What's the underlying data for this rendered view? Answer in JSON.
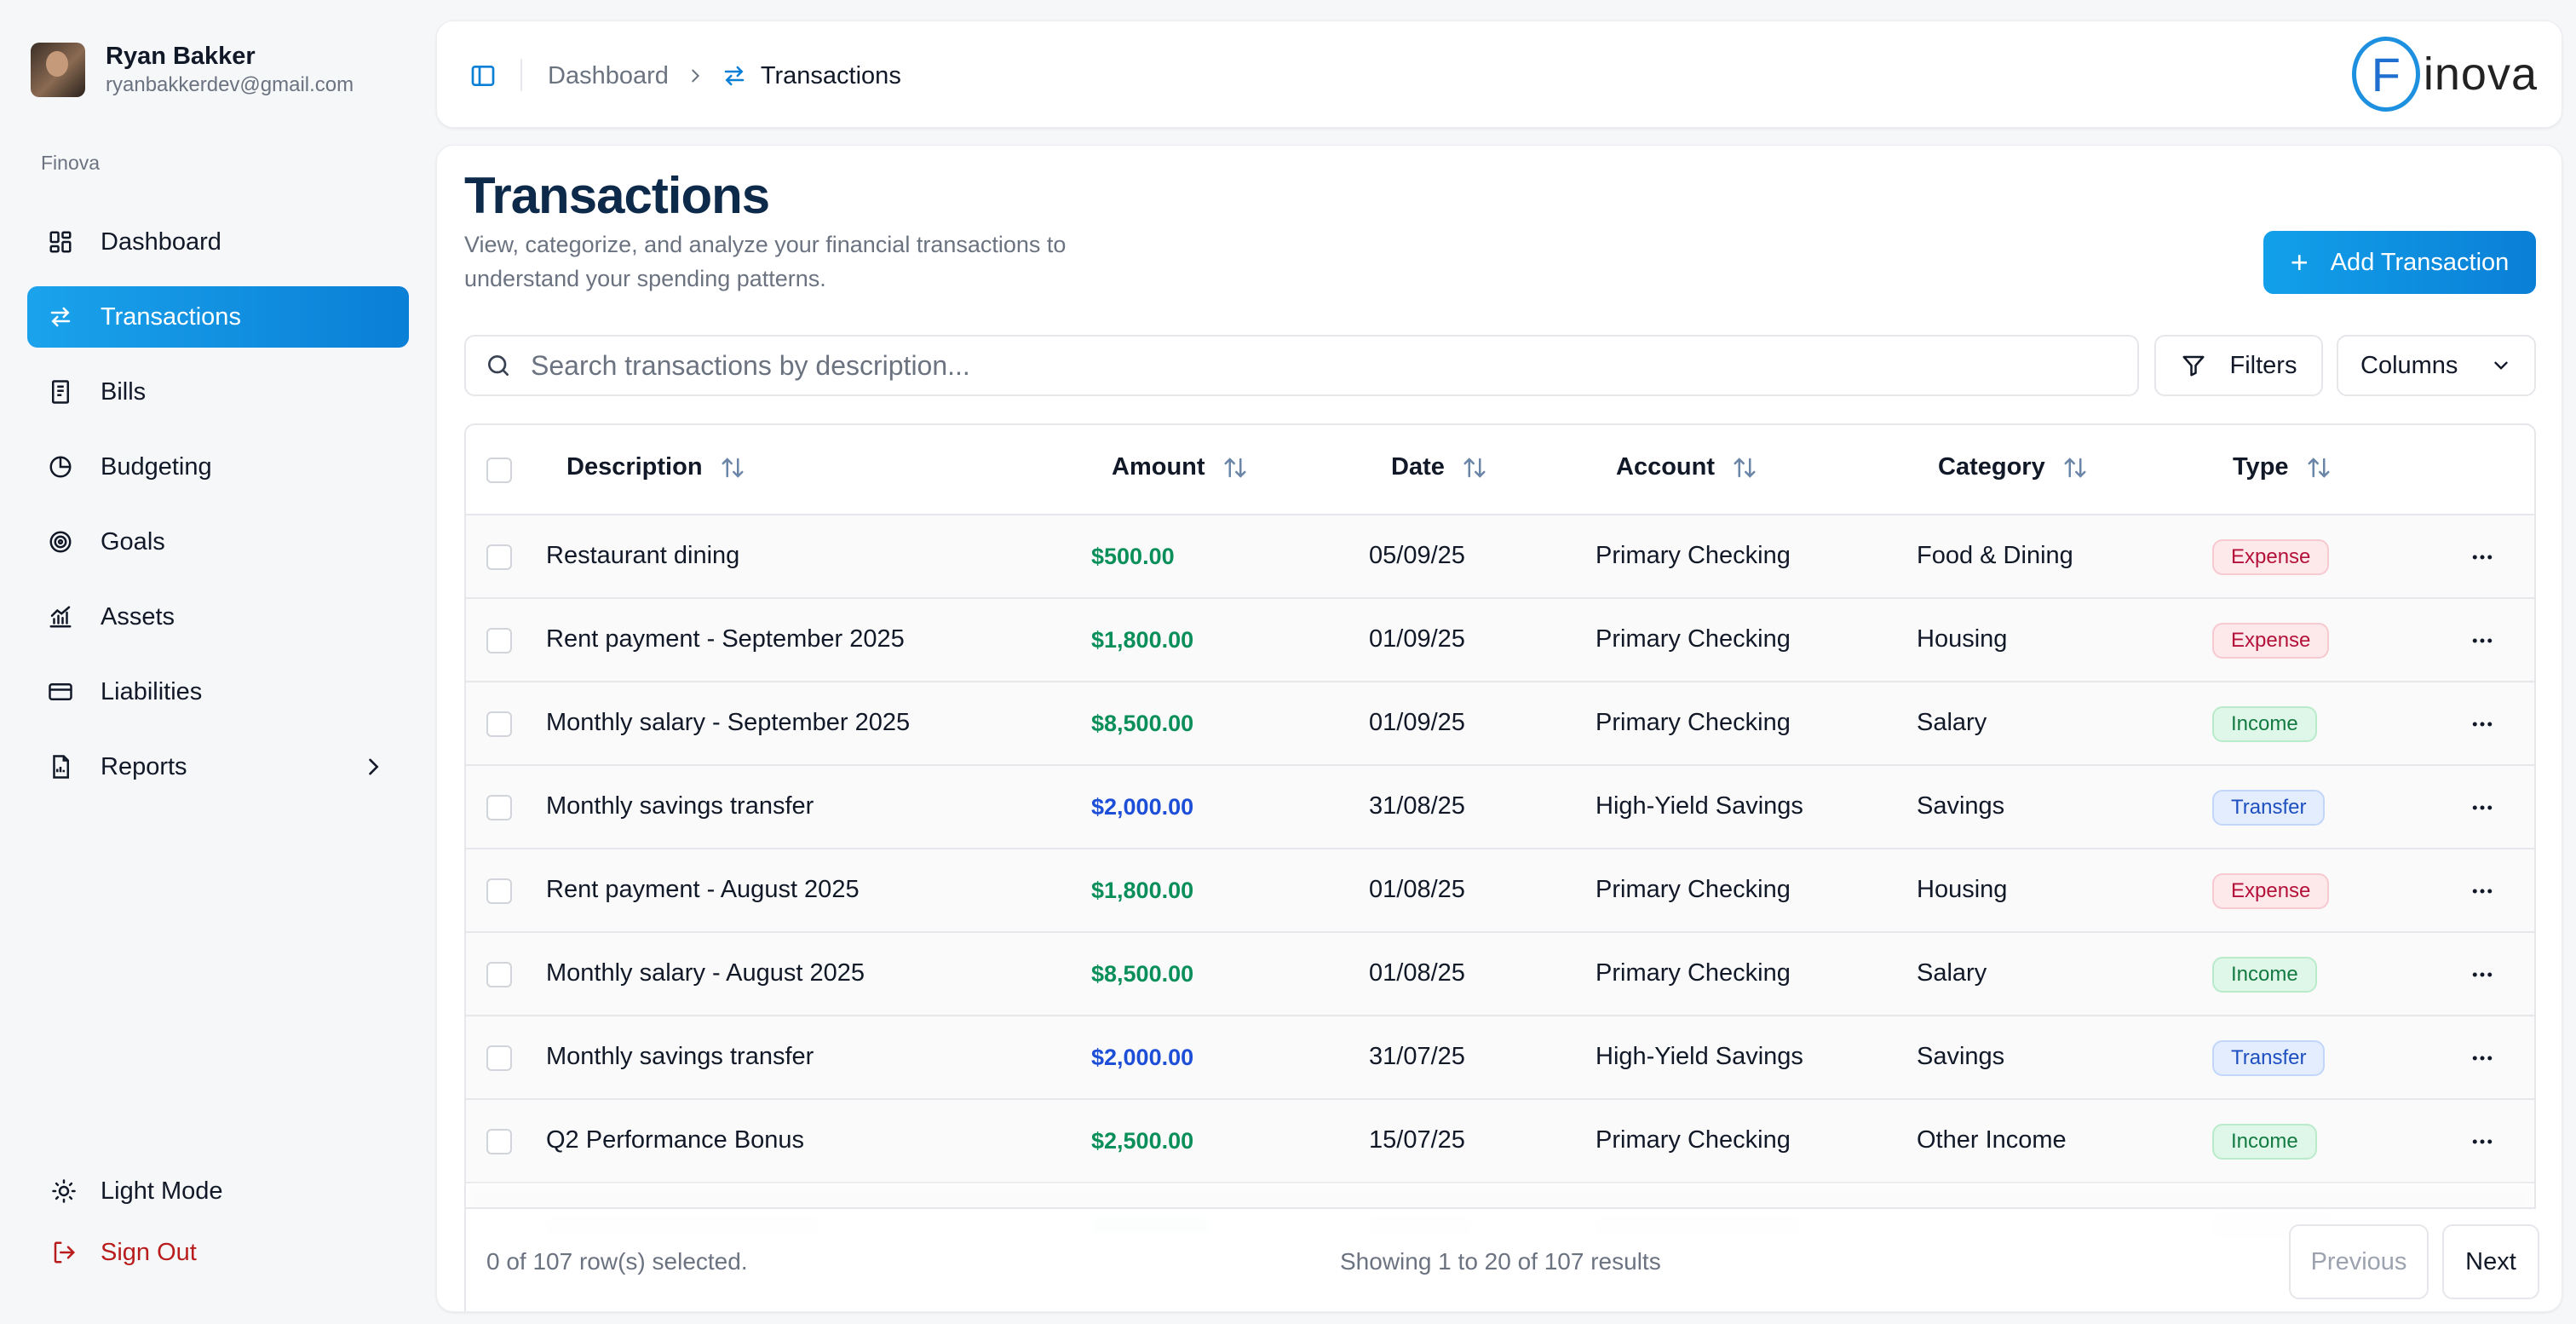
{
  "user": {
    "name": "Ryan Bakker",
    "email": "ryanbakkerdev@gmail.com"
  },
  "sidebar": {
    "group_label": "Finova",
    "items": [
      {
        "label": "Dashboard",
        "icon": "grid-icon"
      },
      {
        "label": "Transactions",
        "icon": "arrows-swap-icon",
        "active": true
      },
      {
        "label": "Bills",
        "icon": "receipt-icon"
      },
      {
        "label": "Budgeting",
        "icon": "pie-chart-icon"
      },
      {
        "label": "Goals",
        "icon": "target-icon"
      },
      {
        "label": "Assets",
        "icon": "trend-chart-icon"
      },
      {
        "label": "Liabilities",
        "icon": "credit-card-icon"
      },
      {
        "label": "Reports",
        "icon": "report-file-icon",
        "has_submenu": true
      }
    ],
    "light_mode_label": "Light Mode",
    "sign_out_label": "Sign Out"
  },
  "header": {
    "breadcrumb_parent": "Dashboard",
    "breadcrumb_current": "Transactions",
    "logo_letter": "F",
    "logo_text": "inova"
  },
  "page": {
    "title": "Transactions",
    "subtitle": "View, categorize, and analyze your financial transactions to understand your spending patterns.",
    "add_button": "Add Transaction",
    "search_placeholder": "Search transactions by description...",
    "filters_label": "Filters",
    "columns_label": "Columns"
  },
  "table": {
    "headers": {
      "description": "Description",
      "amount": "Amount",
      "date": "Date",
      "account": "Account",
      "category": "Category",
      "type": "Type"
    },
    "rows": [
      {
        "description": "Restaurant dining",
        "amount": "$500.00",
        "date": "05/09/25",
        "account": "Primary Checking",
        "category": "Food & Dining",
        "type": "Expense"
      },
      {
        "description": "Rent payment - September 2025",
        "amount": "$1,800.00",
        "date": "01/09/25",
        "account": "Primary Checking",
        "category": "Housing",
        "type": "Expense"
      },
      {
        "description": "Monthly salary - September 2025",
        "amount": "$8,500.00",
        "date": "01/09/25",
        "account": "Primary Checking",
        "category": "Salary",
        "type": "Income"
      },
      {
        "description": "Monthly savings transfer",
        "amount": "$2,000.00",
        "date": "31/08/25",
        "account": "High-Yield Savings",
        "category": "Savings",
        "type": "Transfer"
      },
      {
        "description": "Rent payment - August 2025",
        "amount": "$1,800.00",
        "date": "01/08/25",
        "account": "Primary Checking",
        "category": "Housing",
        "type": "Expense"
      },
      {
        "description": "Monthly salary - August 2025",
        "amount": "$8,500.00",
        "date": "01/08/25",
        "account": "Primary Checking",
        "category": "Salary",
        "type": "Income"
      },
      {
        "description": "Monthly savings transfer",
        "amount": "$2,000.00",
        "date": "31/07/25",
        "account": "High-Yield Savings",
        "category": "Savings",
        "type": "Transfer"
      },
      {
        "description": "Q2 Performance Bonus",
        "amount": "$2,500.00",
        "date": "15/07/25",
        "account": "Primary Checking",
        "category": "Other Income",
        "type": "Income"
      }
    ]
  },
  "footer": {
    "selected_text": "0 of 107 row(s) selected.",
    "showing_text": "Showing 1 to 20 of 107 results",
    "previous_label": "Previous",
    "next_label": "Next"
  },
  "colors": {
    "accent": "#0a8fe0",
    "amount_green": "#0a8f5a",
    "amount_blue": "#1d4ed8",
    "danger": "#b91c1c"
  }
}
